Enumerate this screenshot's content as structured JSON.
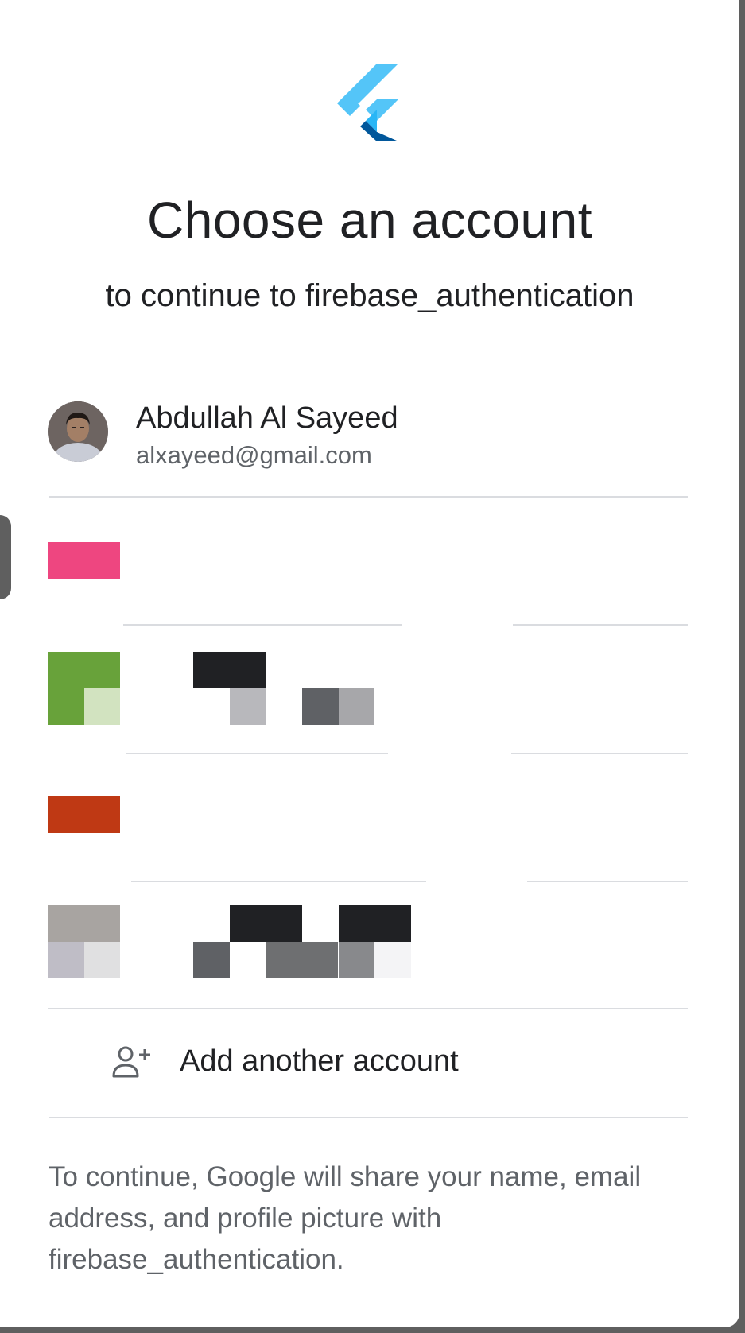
{
  "header": {
    "logo_icon": "flutter-logo",
    "title": "Choose an account",
    "subtitle": "to continue to firebase_authentication"
  },
  "accounts": [
    {
      "name": "Abdullah Al Sayeed",
      "email": "alxayeed@gmail.com",
      "avatar_icon": "profile-photo"
    }
  ],
  "add_account": {
    "icon": "person-add-icon",
    "label": "Add another account"
  },
  "footer": {
    "text": "To continue, Google will share your name, email address, and profile picture with firebase_authentication."
  },
  "colors": {
    "text_primary": "#202124",
    "text_secondary": "#5f6368",
    "divider": "#dadce0",
    "flutter_light": "#54c5f8",
    "flutter_dark": "#01579b"
  }
}
